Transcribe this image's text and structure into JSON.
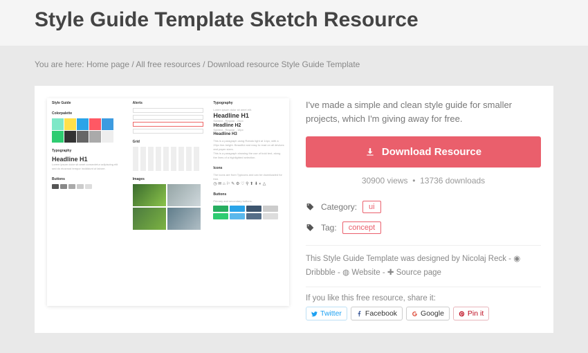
{
  "title": "Style Guide Template Sketch Resource",
  "breadcrumb": {
    "prefix": "You are here:",
    "home": "Home page",
    "all": "All free resources",
    "current": "Download resource Style Guide Template"
  },
  "description": "I've made a simple and clean style guide for smaller projects, which I'm giving away for free.",
  "download_label": "Download Resource",
  "stats": {
    "views": "30900 views",
    "sep": "•",
    "downloads": "13736 downloads"
  },
  "meta": {
    "category_label": "Category:",
    "category_value": "ui",
    "tag_label": "Tag:",
    "tag_value": "concept"
  },
  "credit": {
    "text": "This Style Guide Template was designed by Nicolaj Reck  -",
    "dribbble": "Dribbble",
    "website": "Website",
    "source": "Source page"
  },
  "share": {
    "label": "If you like this free resource, share it:",
    "twitter": "Twitter",
    "facebook": "Facebook",
    "google": "Google",
    "pinit": "Pin it"
  },
  "preview": {
    "style_guide": "Style Guide",
    "headline1": "Headline H1",
    "headline2": "Headline H2",
    "headline3": "Headline H3",
    "typo": "Typography",
    "icons": "Icons",
    "buttons": "Buttons",
    "images": "Images",
    "grid": "Grid",
    "alerts": "Alerts",
    "colors": "Colorpalette",
    "typography": "Typography"
  }
}
